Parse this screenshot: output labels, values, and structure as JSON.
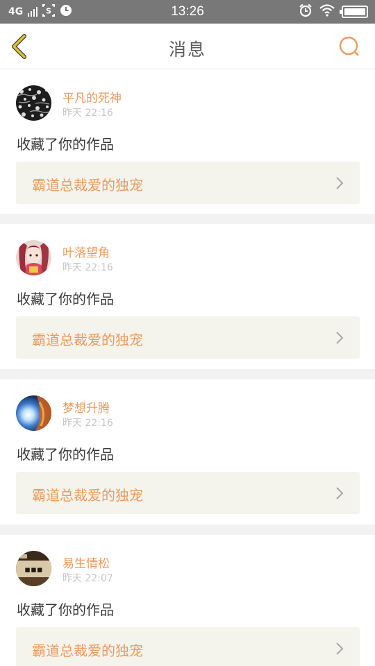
{
  "status_bar": {
    "network": "4G",
    "time": "13:26",
    "icons": [
      "signal-icon",
      "screenshot-icon",
      "clock-icon",
      "alarm-icon",
      "wifi-icon",
      "battery-icon"
    ]
  },
  "nav": {
    "title": "消息",
    "back_icon": "chevron-left-icon",
    "search_icon": "search-icon"
  },
  "messages": [
    {
      "user": "平凡的死神",
      "time": "昨天 22:16",
      "action": "收藏了你的作品",
      "work": "霸道总裁爱的独宠"
    },
    {
      "user": "叶落望角",
      "time": "昨天 22:16",
      "action": "收藏了你的作品",
      "work": "霸道总裁爱的独宠"
    },
    {
      "user": "梦想升腾",
      "time": "昨天 22:16",
      "action": "收藏了你的作品",
      "work": "霸道总裁爱的独宠"
    },
    {
      "user": "易生情松",
      "time": "昨天 22:07",
      "action": "收藏了你的作品",
      "work": "霸道总裁爱的独宠"
    }
  ],
  "colors": {
    "accent": "#ec9a5e",
    "back_arrow": "#e4c22f",
    "status_bar": "#787878",
    "link_bg": "#f4f4ec"
  }
}
